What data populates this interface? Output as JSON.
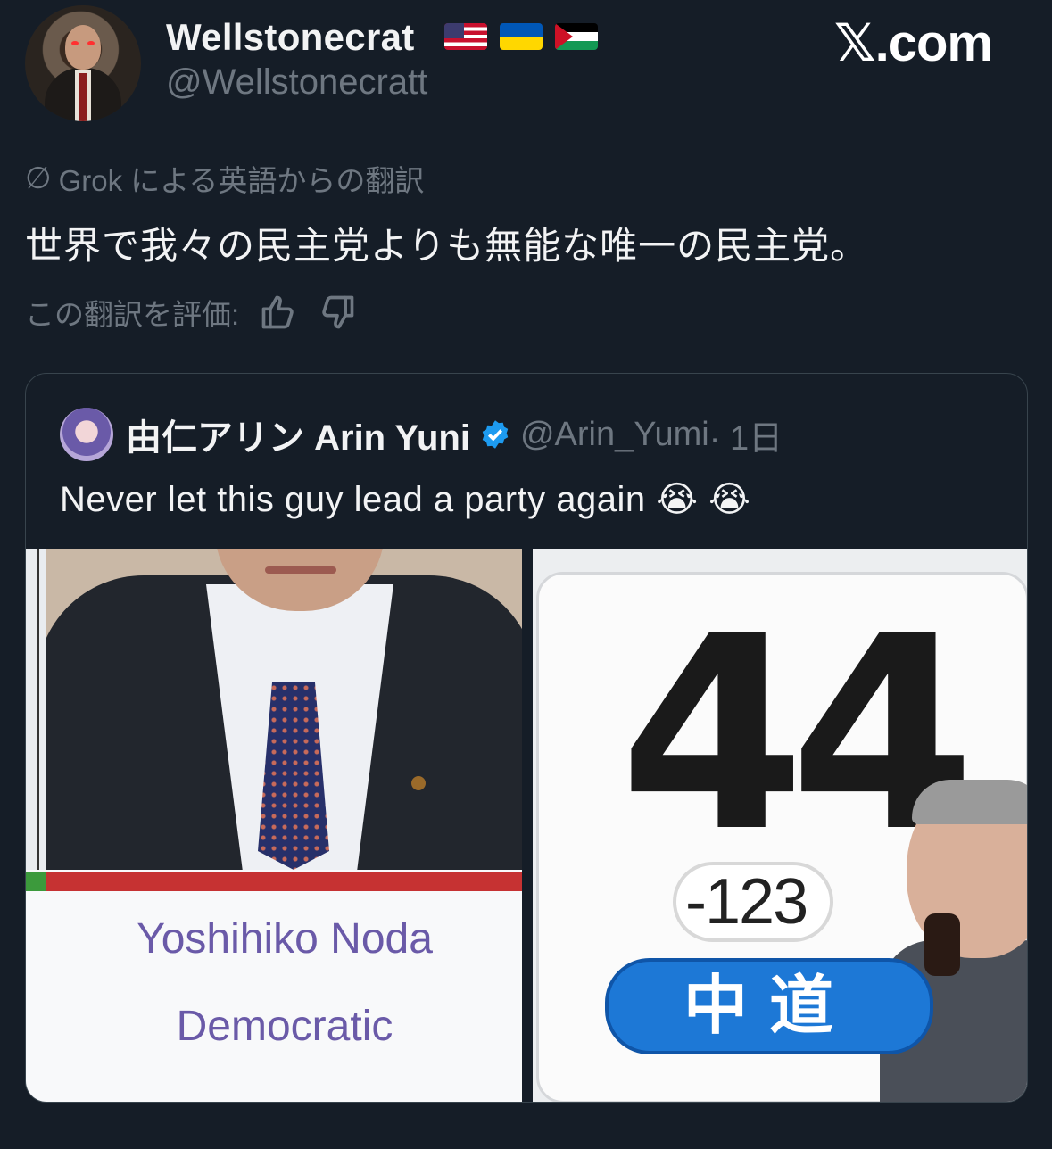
{
  "header": {
    "display_name": "Wellstonecrat",
    "flags": [
      "us-flag",
      "ukraine-flag",
      "palestine-flag"
    ],
    "handle": "@Wellstonecratt",
    "brand": "𝕏.com"
  },
  "translation": {
    "label": "Grok による英語からの翻訳",
    "text": "世界で我々の民主党よりも無能な唯一の民主党。",
    "rate_label": "この翻訳を評価:"
  },
  "quote": {
    "name": "由仁アリン Arin Yuni",
    "handle": "@Arin_Yumi",
    "time": "· 1日",
    "text": "Never let this guy lead a party again 😭 😭",
    "left_image": {
      "person_name": "Yoshihiko Noda",
      "party": "Democratic"
    },
    "right_image": {
      "seats": "44",
      "change": "-123",
      "party_badge": "中道"
    }
  },
  "colors": {
    "background": "#151d27",
    "verified": "#1d9bf0",
    "badge": "#1d78d6"
  }
}
